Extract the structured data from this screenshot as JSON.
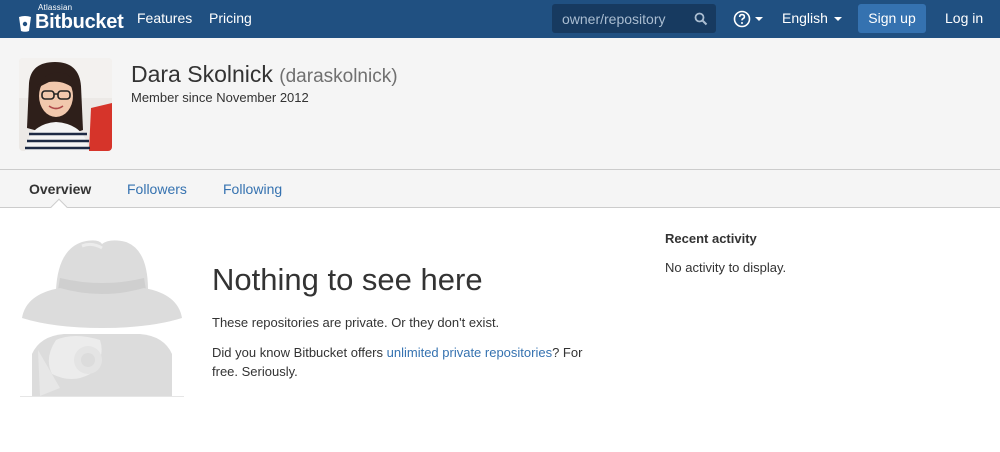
{
  "nav": {
    "logo_small": "Atlassian",
    "logo_text": "Bitbucket",
    "features": "Features",
    "pricing": "Pricing",
    "search_placeholder": "owner/repository",
    "language": "English",
    "signup": "Sign up",
    "login": "Log in"
  },
  "profile": {
    "name": "Dara Skolnick",
    "username": "(daraskolnick)",
    "member_since": "Member since November 2012"
  },
  "tabs": [
    {
      "label": "Overview",
      "active": true
    },
    {
      "label": "Followers",
      "active": false
    },
    {
      "label": "Following",
      "active": false
    }
  ],
  "empty_state": {
    "title": "Nothing to see here",
    "line1": "These repositories are private. Or they don't exist.",
    "line2_before": "Did you know Bitbucket offers ",
    "line2_link": "unlimited private repositories",
    "line2_after": "? For free. Seriously."
  },
  "activity": {
    "heading": "Recent activity",
    "empty": "No activity to display."
  },
  "colors": {
    "nav_bg": "#205081",
    "primary": "#3572b0",
    "header_bg": "#f5f5f5"
  }
}
